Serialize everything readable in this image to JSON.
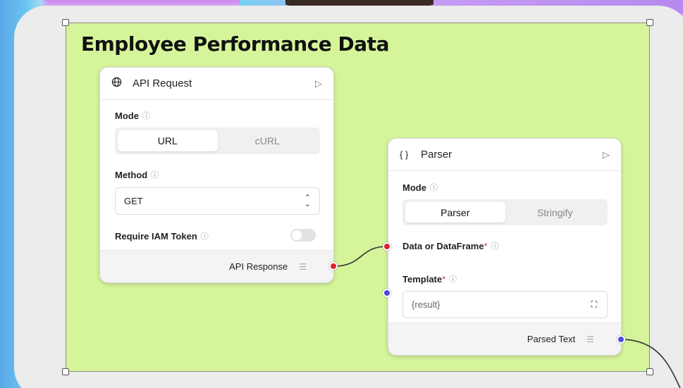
{
  "group": {
    "title": "Employee Performance Data",
    "color": "#d6f59a"
  },
  "api_node": {
    "title": "API Request",
    "icon": "globe-icon",
    "mode_label": "Mode",
    "mode_options": [
      "URL",
      "cURL"
    ],
    "mode_selected": "URL",
    "method_label": "Method",
    "method_value": "GET",
    "iam_label": "Require IAM Token",
    "iam_enabled": false,
    "output_label": "API Response"
  },
  "parser_node": {
    "title": "Parser",
    "icon_text": "{ }",
    "mode_label": "Mode",
    "mode_options": [
      "Parser",
      "Stringify"
    ],
    "mode_selected": "Parser",
    "data_label": "Data or DataFrame",
    "required_mark": "*",
    "template_label": "Template",
    "template_value": "{result}",
    "output_label": "Parsed Text"
  },
  "colors": {
    "port_red": "#d9252b",
    "port_blue": "#4a4ae0"
  }
}
